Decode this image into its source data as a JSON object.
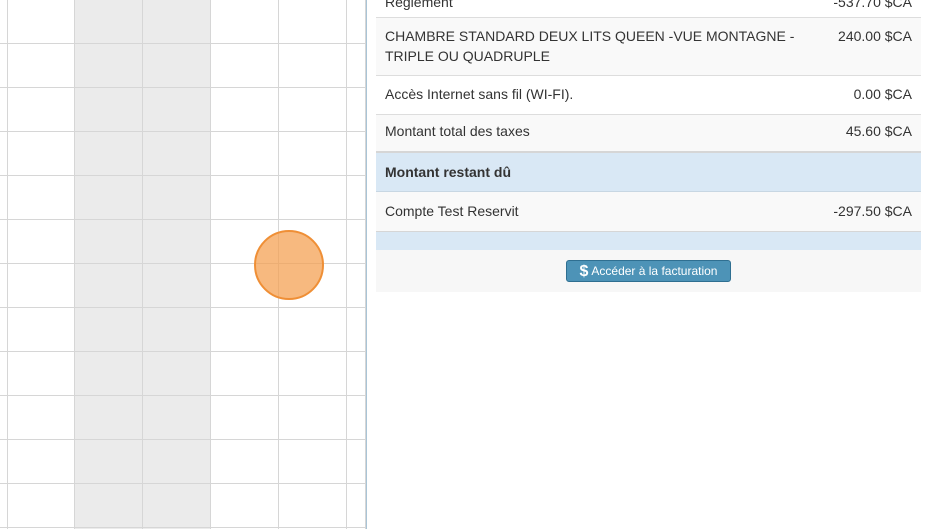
{
  "calendar": {
    "colors": {
      "shaded": "#ebebeb",
      "line": "#d6d6d6"
    }
  },
  "invoice": {
    "rows": [
      {
        "label": "Règlement",
        "amount": "-537.70 $CA"
      },
      {
        "label": "CHAMBRE STANDARD DEUX LITS QUEEN -VUE MONTAGNE -",
        "label2": "TRIPLE OU QUADRUPLE",
        "amount": "240.00 $CA"
      },
      {
        "label": "Accès Internet sans fil (WI-FI).",
        "amount": "0.00 $CA"
      },
      {
        "label": "Montant total des taxes",
        "amount": "45.60 $CA"
      }
    ],
    "due_header": "Montant restant dû",
    "due_rows": [
      {
        "label": "Compte Test Reservit",
        "amount": "-297.50 $CA"
      }
    ],
    "billing_button": {
      "icon": "dollar-icon",
      "glyph": "$",
      "label": "Accéder à la facturation"
    },
    "colors": {
      "header_bg": "#d9e8f5",
      "button_bg": "#4d93b7",
      "marker": "#f49e4e"
    }
  }
}
